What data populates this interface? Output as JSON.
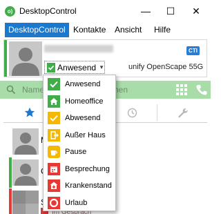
{
  "window": {
    "title": "DesktopControl",
    "logo_text": "o)",
    "minimize_glyph": "—",
    "maximize_glyph": "☐",
    "close_glyph": "✕"
  },
  "menu": {
    "items": [
      "DesktopControl",
      "Kontakte",
      "Ansicht",
      "Hilfe"
    ]
  },
  "header": {
    "badge": "CTI",
    "status_selected": "Anwesend",
    "phone_name": "unify OpenScape 55G"
  },
  "search": {
    "placeholder_start": "Name",
    "placeholder_end": "hen"
  },
  "status_menu": {
    "options": [
      {
        "label": "Anwesend",
        "icon": "check-icon",
        "color": "#3fae49"
      },
      {
        "label": "Homeoffice",
        "icon": "home-icon",
        "color": "#3fae49"
      },
      {
        "label": "Abwesend",
        "icon": "check-icon",
        "color": "#f5b800"
      },
      {
        "label": "Außer Haus",
        "icon": "door-exit-icon",
        "color": "#f5b800"
      },
      {
        "label": "Pause",
        "icon": "coffee-icon",
        "color": "#f5b800"
      },
      {
        "label": "Besprechung",
        "icon": "calendar-icon",
        "color": "#e53935"
      },
      {
        "label": "Krankenstand",
        "icon": "medical-icon",
        "color": "#e53935"
      },
      {
        "label": "Urlaub",
        "icon": "lifebuoy-icon",
        "color": "#e53935"
      }
    ]
  },
  "contacts": [
    {
      "initial": "M",
      "status_color": ""
    },
    {
      "initial": "C",
      "status_color": "#3fae49"
    },
    {
      "initial": "S",
      "status_color": "#e53935",
      "status_text": "Im Gespräch"
    }
  ],
  "colors": {
    "accent": "#1a78cf",
    "available": "#3fae49",
    "away": "#f5b800",
    "busy": "#e53935",
    "search_bg": "#a8dca8"
  }
}
